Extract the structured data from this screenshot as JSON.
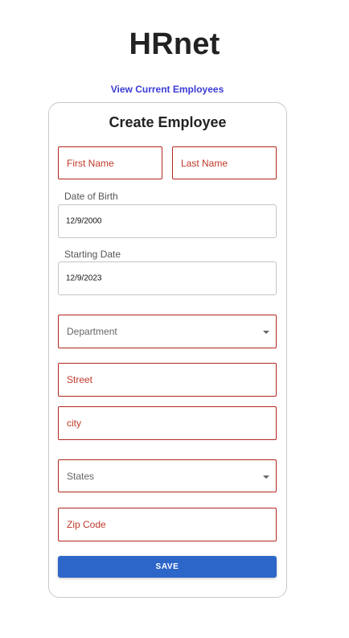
{
  "header": {
    "title": "HRnet",
    "nav_link": "View Current Employees"
  },
  "form": {
    "title": "Create Employee",
    "first_name": {
      "placeholder": "First Name",
      "value": ""
    },
    "last_name": {
      "placeholder": "Last Name",
      "value": ""
    },
    "date_of_birth": {
      "label": "Date of Birth",
      "value": "12/9/2000"
    },
    "start_date": {
      "label": "Starting Date",
      "value": "12/9/2023"
    },
    "department": {
      "placeholder": "Department",
      "value": ""
    },
    "street": {
      "placeholder": "Street",
      "value": ""
    },
    "city": {
      "placeholder": "city",
      "value": ""
    },
    "state": {
      "placeholder": "States",
      "value": ""
    },
    "zip_code": {
      "placeholder": "Zip Code",
      "value": ""
    },
    "save_label": "SAVE"
  },
  "colors": {
    "error_border": "#b3261e",
    "link": "#3b3bd6",
    "button": "#2d66c9"
  },
  "icons": {
    "select_caret": "chevron-down-icon"
  }
}
